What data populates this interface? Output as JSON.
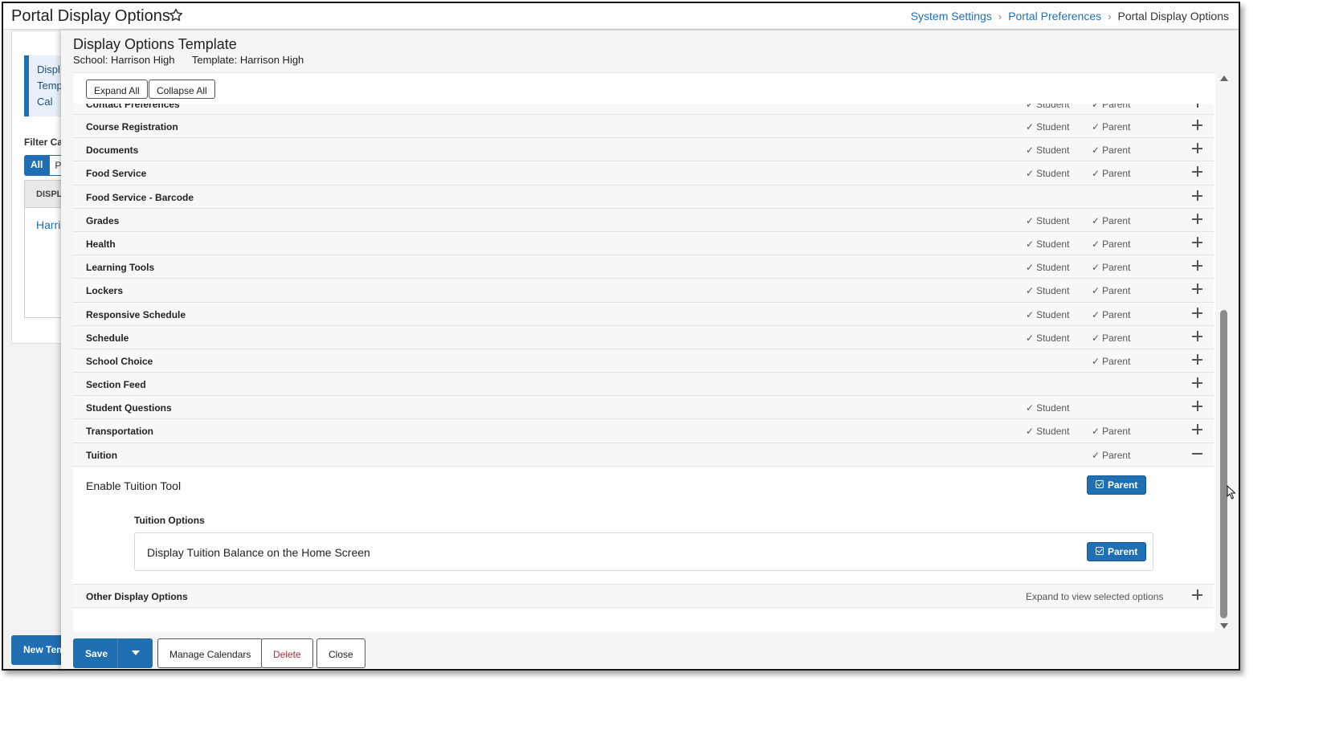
{
  "header": {
    "title": "Portal Display Options",
    "breadcrumb": [
      "System Settings",
      "Portal Preferences",
      "Portal Display Options"
    ]
  },
  "background_page": {
    "info_text": "Displ Temp a Cal",
    "filter_label": "Filter Cal",
    "tab_all": "All",
    "tab_partial": "P",
    "table_header": "DISPL",
    "table_link": "Harris",
    "new_button": "New Tem"
  },
  "modal": {
    "title": "Display Options Template",
    "school": "School: Harrison High",
    "template": "Template: Harrison High",
    "expand_all": "Expand All",
    "collapse_all": "Collapse All"
  },
  "rows": [
    {
      "name": "Contact Preferences",
      "student": "Student",
      "parent": "Parent",
      "cut": true
    },
    {
      "name": "Course Registration",
      "student": "Student",
      "parent": "Parent"
    },
    {
      "name": "Documents",
      "student": "Student",
      "parent": "Parent"
    },
    {
      "name": "Food Service",
      "student": "Student",
      "parent": "Parent"
    },
    {
      "name": "Food Service - Barcode",
      "student": "",
      "parent": ""
    },
    {
      "name": "Grades",
      "student": "Student",
      "parent": "Parent"
    },
    {
      "name": "Health",
      "student": "Student",
      "parent": "Parent"
    },
    {
      "name": "Learning Tools",
      "student": "Student",
      "parent": "Parent"
    },
    {
      "name": "Lockers",
      "student": "Student",
      "parent": "Parent"
    },
    {
      "name": "Responsive Schedule",
      "student": "Student",
      "parent": "Parent"
    },
    {
      "name": "Schedule",
      "student": "Student",
      "parent": "Parent"
    },
    {
      "name": "School Choice",
      "student": "",
      "parent": "Parent"
    },
    {
      "name": "Section Feed",
      "student": "",
      "parent": ""
    },
    {
      "name": "Student Questions",
      "student": "Student",
      "parent": ""
    },
    {
      "name": "Transportation",
      "student": "Student",
      "parent": "Parent"
    },
    {
      "name": "Tuition",
      "student": "",
      "parent": "Parent",
      "expanded": true
    }
  ],
  "tuition": {
    "enable_label": "Enable Tuition Tool",
    "enable_button": "Parent",
    "options_title": "Tuition Options",
    "option_label": "Display Tuition Balance on the Home Screen",
    "option_button": "Parent"
  },
  "other": {
    "name": "Other Display Options",
    "note": "Expand to view selected options"
  },
  "footer": {
    "save": "Save",
    "manage": "Manage Calendars",
    "delete": "Delete",
    "close": "Close"
  },
  "colors": {
    "accent": "#1f6fb2",
    "danger": "#c0262d"
  }
}
